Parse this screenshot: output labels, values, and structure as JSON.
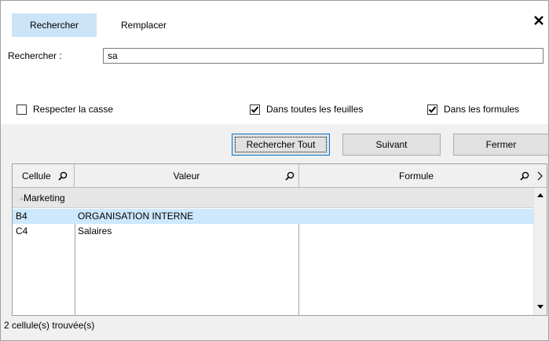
{
  "tabs": [
    {
      "label": "Rechercher",
      "active": true
    },
    {
      "label": "Remplacer",
      "active": false
    }
  ],
  "search": {
    "label": "Rechercher :",
    "value": "sa"
  },
  "options": {
    "match_case": {
      "label": "Respecter la casse",
      "checked": false
    },
    "all_sheets": {
      "label": "Dans toutes les feuilles",
      "checked": true
    },
    "in_formulas": {
      "label": "Dans les formules",
      "checked": true
    }
  },
  "buttons": {
    "find_all": "Rechercher Tout",
    "next": "Suivant",
    "close": "Fermer"
  },
  "table": {
    "columns": [
      "Cellule",
      "Valeur",
      "Formule"
    ],
    "group": "Marketing",
    "rows": [
      {
        "cell": "B4",
        "value": "ORGANISATION INTERNE",
        "formula": "",
        "selected": true
      },
      {
        "cell": "C4",
        "value": "Salaires",
        "formula": "",
        "selected": false
      }
    ]
  },
  "status": "2 cellule(s) trouvée(s)",
  "colors": {
    "active_tab": "#cce4f7",
    "selected_row": "#cce8ff",
    "default_button_border": "#0078d7"
  },
  "icons": [
    "close-icon",
    "search-icon",
    "chevron-right-icon",
    "scroll-up-icon",
    "scroll-down-icon",
    "collapse-triangle-icon",
    "checkmark-icon"
  ]
}
